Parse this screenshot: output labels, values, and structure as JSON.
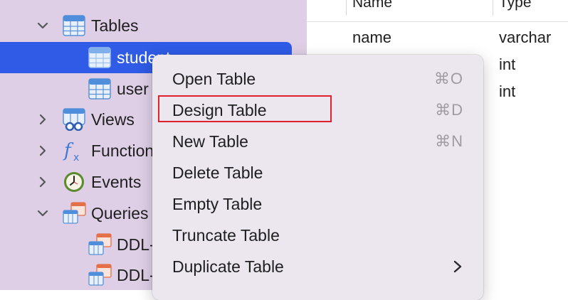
{
  "colors": {
    "sidebar_bg": "#dfcfe6",
    "selection": "#2f5be6",
    "menu_bg": "#ece6ef",
    "highlight_border": "#e0202a",
    "shortcut_text": "#9f9aa3"
  },
  "sidebar": {
    "items": [
      {
        "label": "Tables",
        "icon": "table-icon",
        "expanded": true
      },
      {
        "label": "student",
        "icon": "table-icon",
        "selected": true
      },
      {
        "label": "user",
        "icon": "table-icon"
      },
      {
        "label": "Views",
        "icon": "views-icon",
        "expanded": false
      },
      {
        "label": "Function",
        "icon": "function-icon",
        "expanded": false
      },
      {
        "label": "Events",
        "icon": "clock-icon",
        "expanded": false
      },
      {
        "label": "Queries",
        "icon": "queries-icon",
        "expanded": true
      },
      {
        "label": "DDL-",
        "icon": "query-icon"
      },
      {
        "label": "DDL-",
        "icon": "query-icon"
      }
    ]
  },
  "table_view": {
    "headers": [
      "Name",
      "Type"
    ],
    "rows": [
      {
        "name": "name",
        "type": "varchar"
      },
      {
        "name": "",
        "type": "int"
      },
      {
        "name": "",
        "type": "int"
      }
    ]
  },
  "context_menu": {
    "items": [
      {
        "label": "Open Table",
        "shortcut": "⌘O"
      },
      {
        "label": "Design Table",
        "shortcut": "⌘D",
        "highlighted": true
      },
      {
        "label": "New Table",
        "shortcut": "⌘N"
      },
      {
        "label": "Delete Table",
        "shortcut": ""
      },
      {
        "label": "Empty Table",
        "shortcut": ""
      },
      {
        "label": "Truncate Table",
        "shortcut": ""
      },
      {
        "label": "Duplicate Table",
        "shortcut": "",
        "submenu": true
      }
    ]
  }
}
